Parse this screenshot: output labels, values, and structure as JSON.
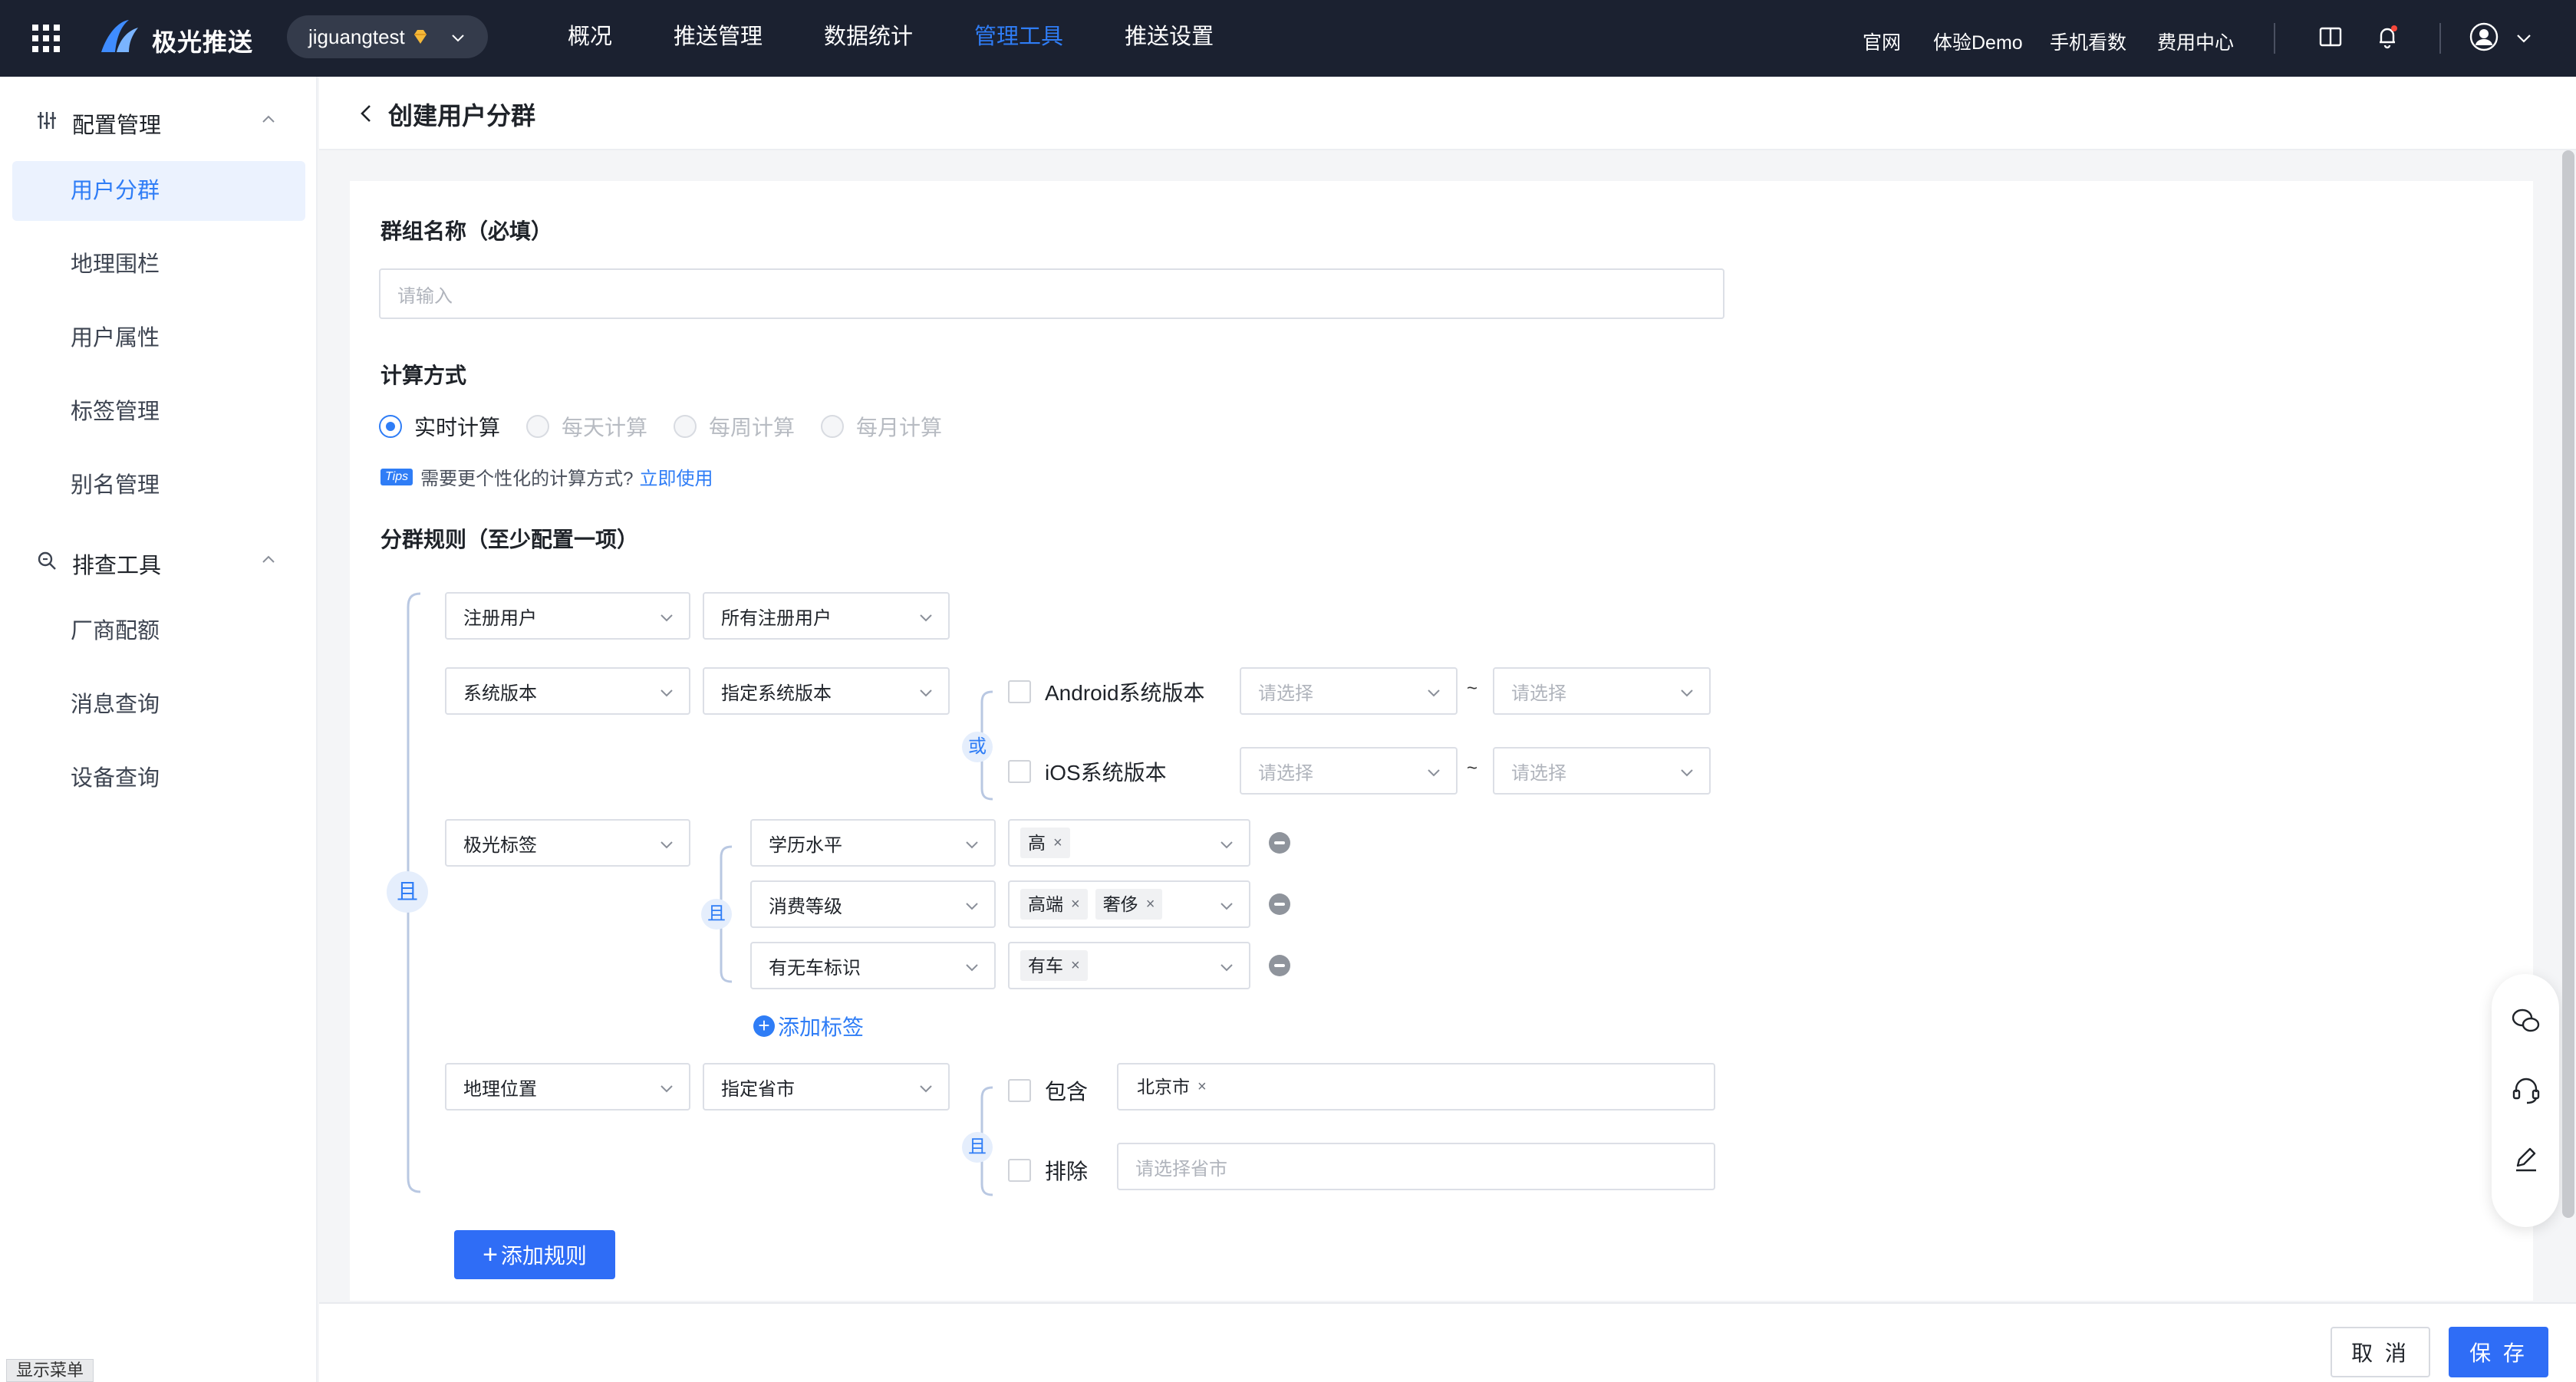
{
  "brand": {
    "name": "极光推送",
    "app": "jiguangtest"
  },
  "nav": {
    "items": [
      "概况",
      "推送管理",
      "数据统计",
      "管理工具",
      "推送设置"
    ],
    "active": "管理工具"
  },
  "toplinks": {
    "site": "官网",
    "demo": "体验Demo",
    "mobile": "手机看数",
    "billing": "费用中心"
  },
  "sidebar": {
    "group1": "配置管理",
    "group1_items": [
      "用户分群",
      "地理围栏",
      "用户属性",
      "标签管理",
      "别名管理"
    ],
    "group2": "排查工具",
    "group2_items": [
      "厂商配额",
      "消息查询",
      "设备查询"
    ],
    "active": "用户分群",
    "show_menu": "显示菜单"
  },
  "page": {
    "title": "创建用户分群"
  },
  "form": {
    "group_name_label": "群组名称（必填）",
    "group_name_placeholder": "请输入",
    "calc_label": "计算方式",
    "calc_options": [
      "实时计算",
      "每天计算",
      "每周计算",
      "每月计算"
    ],
    "calc_selected": "实时计算",
    "tips_badge": "Tips",
    "tips_text": "需要更个性化的计算方式?",
    "tips_link": "立即使用",
    "rules_label": "分群规则（至少配置一项）",
    "and": "且",
    "or": "或",
    "tilde": "~",
    "rule1": {
      "field": "注册用户",
      "op": "所有注册用户"
    },
    "rule2": {
      "field": "系统版本",
      "op": "指定系统版本",
      "android": "Android系统版本",
      "ios": "iOS系统版本",
      "placeholder": "请选择"
    },
    "rule3": {
      "field": "极光标签",
      "tags": [
        {
          "name": "学历水平",
          "values": [
            "高"
          ]
        },
        {
          "name": "消费等级",
          "values": [
            "高端",
            "奢侈"
          ]
        },
        {
          "name": "有无车标识",
          "values": [
            "有车"
          ]
        }
      ],
      "add_tag": "添加标签"
    },
    "rule4": {
      "field": "地理位置",
      "op": "指定省市",
      "include": "包含",
      "include_values": [
        "北京市"
      ],
      "exclude": "排除",
      "exclude_placeholder": "请选择省市"
    },
    "add_rule": "添加规则"
  },
  "footer": {
    "cancel": "取 消",
    "save": "保 存"
  },
  "colors": {
    "accent": "#2f7df6",
    "topbar": "#1b2130"
  }
}
